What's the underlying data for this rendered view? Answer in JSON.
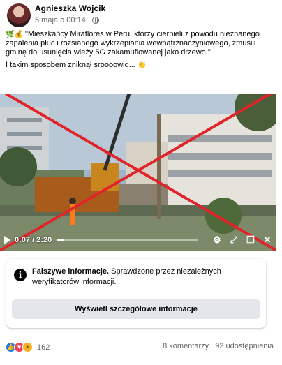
{
  "post": {
    "author": "Agnieszka Wojcik",
    "date": "5 maja o 00:14",
    "dot": "·",
    "text_line1": "\"Mieszkańcy Miraflores w Peru, którzy cierpieli z powodu nieznanego zapalenia płuc i rozsianego wykrzepiania wewnątrznaczyniowego, zmusili gminę do usunięcia wieży 5G zakamuflowanej jako drzewo.\"",
    "text_line2": "I takim sposobem zniknął sroooowid...",
    "emoji_lead": "🌿💰",
    "emoji_tail": "👏"
  },
  "video": {
    "time": "0:07 / 2:20",
    "progress": 0.05,
    "icons": [
      "play-icon",
      "settings-icon",
      "fullscreen-icon",
      "pip-icon",
      "volume-icon"
    ],
    "cross_color": "#e0242a"
  },
  "fact_check": {
    "title": "Fałszywe informacje.",
    "description": "Sprawdzone przez niezależnych weryfikatorów informacji.",
    "button_label": "Wyświetl szczegółowe informacje"
  },
  "footer": {
    "reaction_count": "162",
    "comments": "8 komentarzy",
    "shares": "92 udostępnienia"
  }
}
